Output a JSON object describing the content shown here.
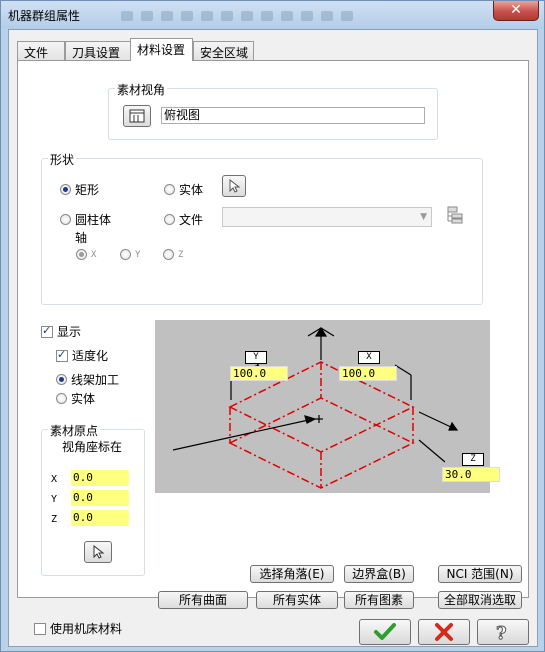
{
  "window": {
    "title": "机器群组属性",
    "close_glyph": "✕"
  },
  "tabs": [
    "文件",
    "刀具设置",
    "材料设置",
    "安全区域"
  ],
  "active_tab": 2,
  "view_group": {
    "label": "素材视角",
    "value": "俯视图"
  },
  "shape_group": {
    "label": "形状",
    "options": {
      "rect": "矩形",
      "solid": "实体",
      "cylinder": "圆柱体",
      "file": "文件"
    },
    "axis_label": "轴",
    "axis_options": [
      "X",
      "Y",
      "Z"
    ]
  },
  "display": {
    "show": "显示",
    "fit": "适度化",
    "wireframe": "线架加工",
    "solid": "实体"
  },
  "origin_group": {
    "label": "素材原点",
    "sublabel": "视角座标在",
    "x_label": "X",
    "x_value": "0.0",
    "y_label": "Y",
    "y_value": "0.0",
    "z_label": "Z",
    "z_value": "0.0"
  },
  "diagram": {
    "y_tag": "Y",
    "y_value": "100.0",
    "x_tag": "X",
    "x_value": "100.0",
    "z_tag": "Z",
    "z_value": "30.0"
  },
  "buttons": {
    "select_corner": "选择角落(E)",
    "bounding_box": "边界盒(B)",
    "nci_range": "NCI 范围(N)",
    "all_surfaces": "所有曲面",
    "all_solids": "所有实体",
    "all_entities": "所有图素",
    "deselect_all": "全部取消选取"
  },
  "use_machine_material": "使用机床材料",
  "colors": {
    "accent_yellow": "#ffff80",
    "diagram_bg": "#c0c0c0",
    "wire_red": "#e00000",
    "ok_green": "#2f9e2f",
    "cancel_red": "#d42a1f"
  }
}
